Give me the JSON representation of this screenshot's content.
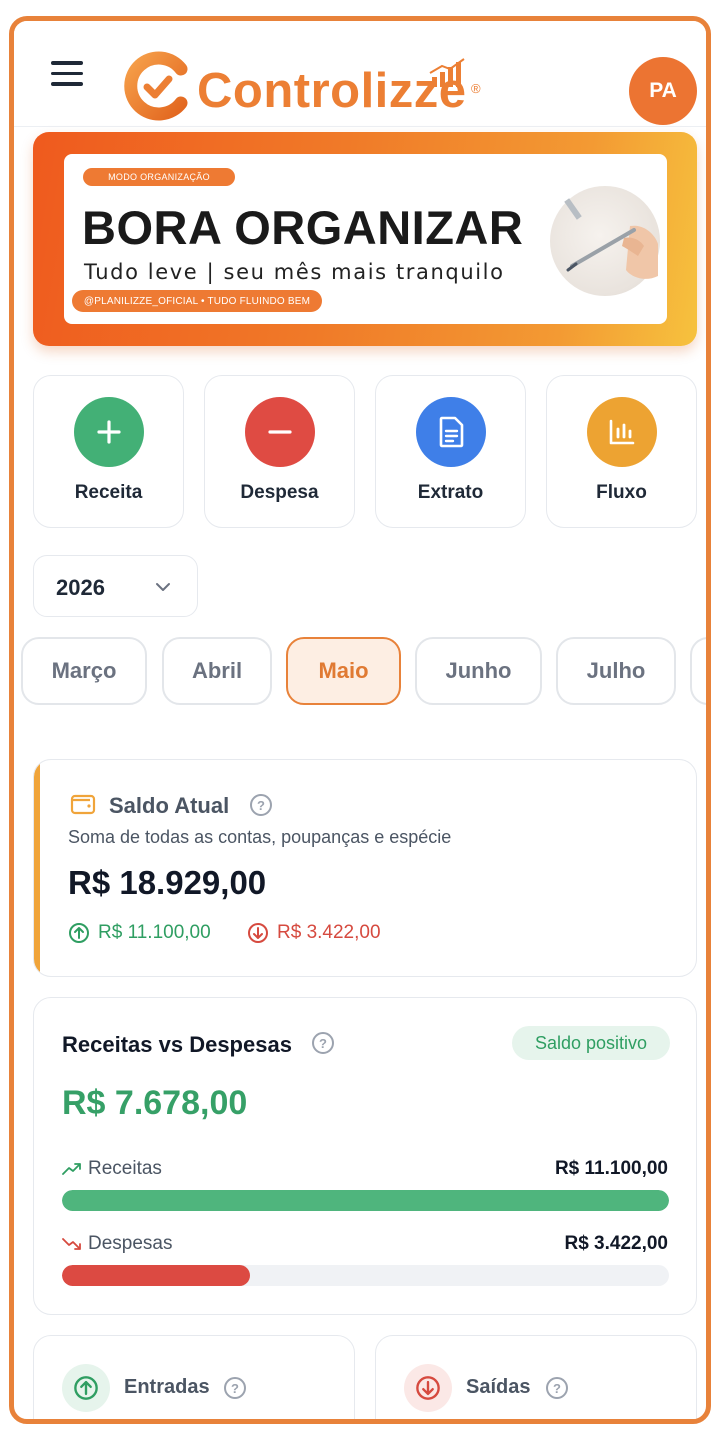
{
  "header": {
    "menu_icon": "hamburger-icon",
    "logo_text": "Controlizze",
    "logo_reg": "®",
    "avatar_initials": "PA",
    "brand_color": "#ec7f34"
  },
  "banner": {
    "tag": "MODO ORGANIZAÇÃO",
    "title": "BORA ORGANIZAR",
    "subtitle": "Tudo leve | seu mês mais tranquilo",
    "handle": "@PLANILIZZE_OFICIAL • TUDO FLUINDO BEM"
  },
  "quick_actions": [
    {
      "label": "Receita",
      "icon": "plus-icon",
      "color": "#43b076"
    },
    {
      "label": "Despesa",
      "icon": "minus-icon",
      "color": "#df4b43"
    },
    {
      "label": "Extrato",
      "icon": "document-icon",
      "color": "#3f7fe8"
    },
    {
      "label": "Fluxo",
      "icon": "bar-chart-icon",
      "color": "#eda332"
    }
  ],
  "year_selector": {
    "value": "2026"
  },
  "months": [
    "Março",
    "Abril",
    "Maio",
    "Junho",
    "Julho"
  ],
  "active_month": "Maio",
  "saldo_atual": {
    "title": "Saldo Atual",
    "description": "Soma de todas as contas, poupanças e espécie",
    "amount": "R$ 18.929,00",
    "income": "R$ 11.100,00",
    "expense": "R$ 3.422,00"
  },
  "receitas_vs_despesas": {
    "title": "Receitas vs Despesas",
    "badge": "Saldo positivo",
    "amount": "R$ 7.678,00",
    "receitas_label": "Receitas",
    "receitas_value": "R$ 11.100,00",
    "receitas_fraction": 1.0,
    "despesas_label": "Despesas",
    "despesas_value": "R$ 3.422,00",
    "despesas_fraction": 0.31,
    "income_color": "#4fb57d",
    "expense_color": "#dc4a42"
  },
  "summary_cards": {
    "entradas_label": "Entradas",
    "saidas_label": "Saídas"
  }
}
